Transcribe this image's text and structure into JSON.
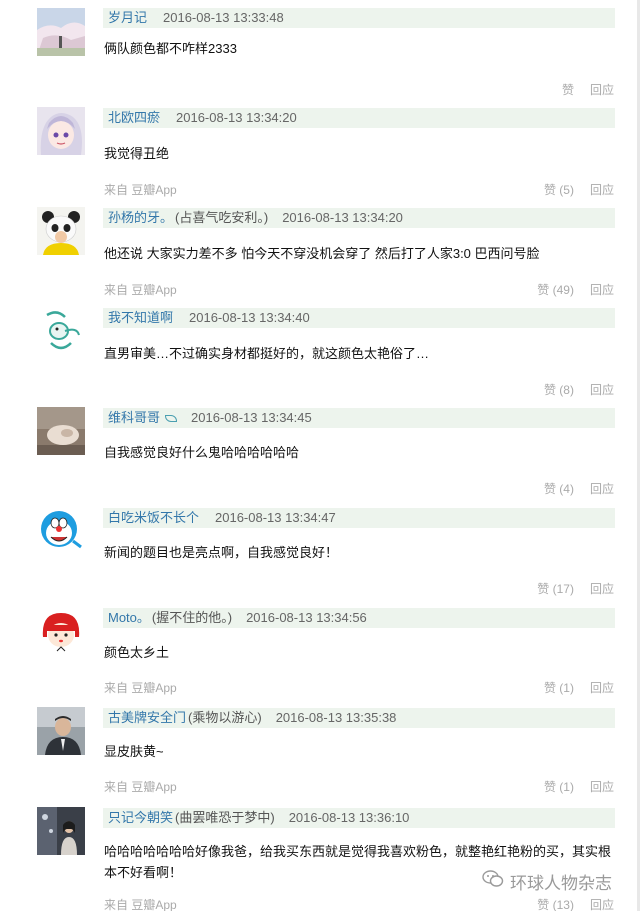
{
  "comments": [
    {
      "user": "岁月记",
      "sig": "",
      "time": "2016-08-13 13:33:48",
      "text": "俩队颜色都不咋样2333",
      "source": "",
      "like": "赞",
      "reply": "回应"
    },
    {
      "user": "北欧四瘀",
      "sig": "",
      "time": "2016-08-13 13:34:20",
      "text": "我觉得丑绝",
      "source": "来自 豆瓣App",
      "like": "赞 (5)",
      "reply": "回应"
    },
    {
      "user": "孙杨的牙。",
      "sig": "(占喜气吃安利。)",
      "time": "2016-08-13 13:34:20",
      "text": "他还说 大家实力差不多 怕今天不穿没机会穿了 然后打了人家3:0 巴西问号脸",
      "source": "来自 豆瓣App",
      "like": "赞 (49)",
      "reply": "回应"
    },
    {
      "user": "我不知道啊",
      "sig": "",
      "time": "2016-08-13 13:34:40",
      "text": "直男审美…不过确实身材都挺好的，就这颜色太艳俗了…",
      "source": "",
      "like": "赞 (8)",
      "reply": "回应"
    },
    {
      "user": "维科哥哥",
      "sig": "",
      "time": "2016-08-13 13:34:45",
      "text": "自我感觉良好什么鬼哈哈哈哈哈哈",
      "source": "",
      "like": "赞 (4)",
      "reply": "回应"
    },
    {
      "user": "白吃米饭不长个",
      "sig": "",
      "time": "2016-08-13 13:34:47",
      "text": "新闻的题目也是亮点啊，自我感觉良好！",
      "source": "",
      "like": "赞 (17)",
      "reply": "回应"
    },
    {
      "user": "Moto。",
      "sig": "(握不住的他。)",
      "time": "2016-08-13 13:34:56",
      "text": "颜色太乡土",
      "source": "来自 豆瓣App",
      "like": "赞 (1)",
      "reply": "回应"
    },
    {
      "user": "古美牌安全门",
      "sig": "(乘物以游心)",
      "time": "2016-08-13 13:35:38",
      "text": "显皮肤黄~",
      "source": "来自 豆瓣App",
      "like": "赞 (1)",
      "reply": "回应"
    },
    {
      "user": "只记今朝笑",
      "sig": "(曲罢唯恐于梦中)",
      "time": "2016-08-13 13:36:10",
      "text": "哈哈哈哈哈哈哈好像我爸，给我买东西就是觉得我喜欢粉色，就整艳红艳粉的买，其实根本不好看啊！",
      "source": "来自 豆瓣App",
      "like": "赞 (13)",
      "reply": "回应"
    }
  ],
  "watermark": "环球人物杂志",
  "colors": {
    "username": "#3377aa",
    "header_bg": "#edf4ed",
    "muted": "#aaaaaa"
  }
}
